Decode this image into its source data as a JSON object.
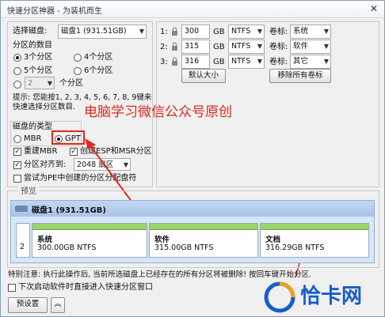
{
  "window": {
    "title": "快速分区神器 - 为装机而生",
    "close_glyph": "✕"
  },
  "left": {
    "select_disk_label": "选择磁盘:",
    "select_disk_value": "磁盘1 (931.51GB)",
    "count_label": "分区的数目",
    "count_options": [
      "3个分区",
      "4个分区",
      "5个分区",
      "6个分区"
    ],
    "custom_count_value": "2",
    "custom_count_suffix": "个分区",
    "hint_line1": "提示: 您能按1, 2, 3, 4, 5, 6, 7, 8, 9键来",
    "hint_line2": "快速选择分区数目.",
    "disk_type_label": "磁盘的类型",
    "mbr": "MBR",
    "gpt": "GPT",
    "rebuild_mbr": "重建MBR",
    "create_esp": "创建ESP和MSR分区",
    "align_label": "分区对齐到:",
    "align_value": "2048 扇区",
    "pe_label": "尝试为PE中创建的分区分配盘符"
  },
  "right": {
    "rows": [
      {
        "num": "1:",
        "size": "300",
        "unit": "GB",
        "fs": "NTFS",
        "vol_label": "卷标:",
        "vol": "系统"
      },
      {
        "num": "2:",
        "size": "315",
        "unit": "GB",
        "fs": "NTFS",
        "vol_label": "卷标:",
        "vol": "软件"
      },
      {
        "num": "3:",
        "size": "316",
        "unit": "GB",
        "fs": "NTFS",
        "vol_label": "卷标:",
        "vol": "其它"
      }
    ],
    "default_size_button": "默认大小",
    "remove_labels_button": "移除所有卷标"
  },
  "watermark": "电脑学习微信公众号原创",
  "preview": {
    "label": "预览",
    "disk_title": "磁盘1 (931.51GB)",
    "partitions": [
      {
        "name": "系统",
        "size": "300.00GB NTFS"
      },
      {
        "name": "软件",
        "size": "315.00GB NTFS"
      },
      {
        "name": "文档",
        "size": "316.29GB NTFS"
      }
    ],
    "index": "2"
  },
  "warning": "特别注意: 执行此操作后, 当前所选磁盘上已经存在的所有分区将被删除! 按回车键开始分区.",
  "next_start": "下次启动软件时直接进入快速分区窗口",
  "preset_button": "预设置",
  "logo_text": "恰卡网",
  "colors": {
    "accent_red": "#e0281e",
    "bar_green": "#9ad46a",
    "disk_blue": "#d7e6f8"
  }
}
